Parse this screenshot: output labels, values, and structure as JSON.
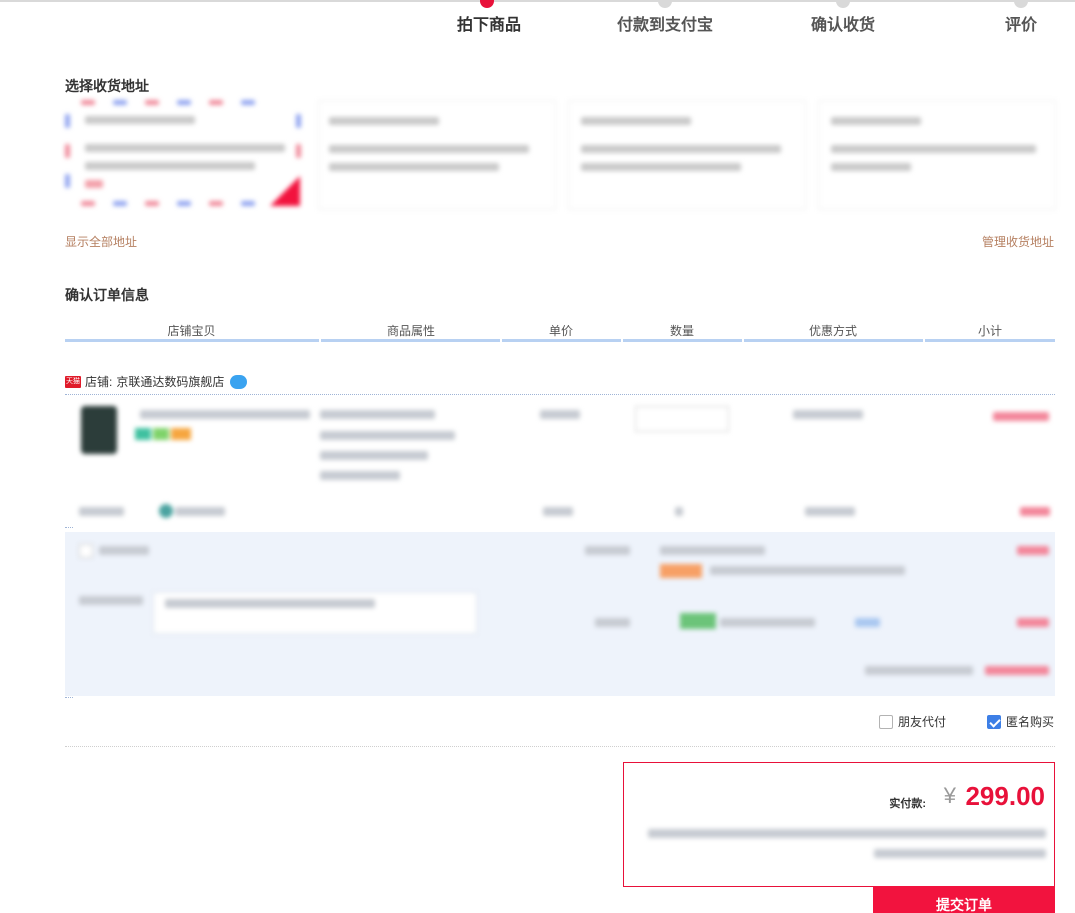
{
  "steps": [
    {
      "label": "拍下商品"
    },
    {
      "label": "付款到支付宝"
    },
    {
      "label": "确认收货"
    },
    {
      "label": "评价"
    }
  ],
  "address": {
    "title": "选择收货地址",
    "show_all": "显示全部地址",
    "manage": "管理收货地址"
  },
  "order": {
    "title": "确认订单信息",
    "columns": [
      "店铺宝贝",
      "商品属性",
      "单价",
      "数量",
      "优惠方式",
      "小计"
    ],
    "shop_prefix": "店铺:",
    "shop_name": "京联通达数码旗舰店",
    "tmall_badge": "天猫"
  },
  "options": {
    "friend_pay": "朋友代付",
    "anonymous": "匿名购买",
    "anonymous_checked": true,
    "friend_pay_checked": false
  },
  "payment": {
    "label": "实付款:",
    "currency": "¥",
    "amount": "299.00",
    "submit": "提交订单"
  },
  "colors": {
    "accent_red": "#e8113a",
    "link_brown": "#b57f60",
    "header_blue": "#b8d1f2",
    "panel_bg": "#eef3fb"
  }
}
